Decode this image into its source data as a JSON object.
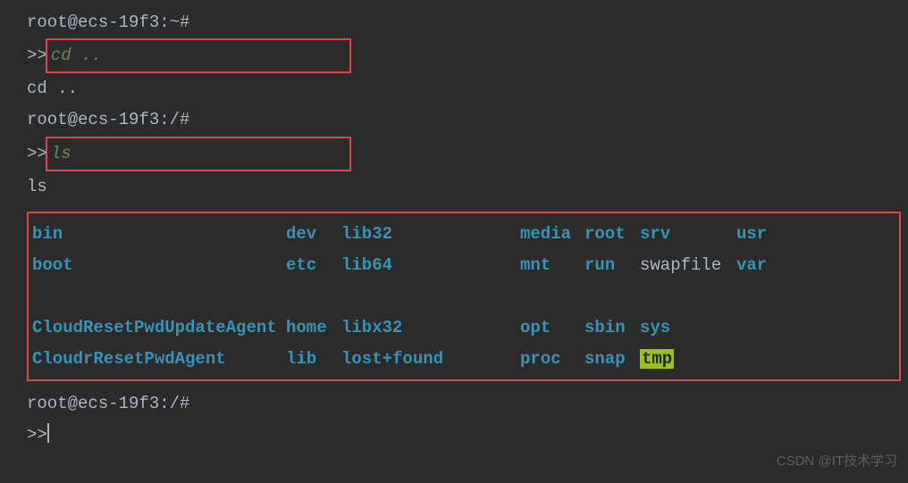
{
  "prompts": {
    "home": "root@ecs-19f3:~#",
    "root": "root@ecs-19f3:/#",
    "angles": ">>"
  },
  "commands": {
    "cd_up": "cd ..",
    "ls": "ls"
  },
  "echo": {
    "cd_up": "cd ..",
    "ls": "ls"
  },
  "ls_output": {
    "row1": {
      "c1": "bin",
      "c2": "dev",
      "c3": "lib32",
      "c4": "media",
      "c5": "root",
      "c6": "srv",
      "c7": "usr"
    },
    "row2": {
      "c1": "boot",
      "c2": "etc",
      "c3": "lib64",
      "c4": "mnt",
      "c5": "run",
      "c6": "swapfile",
      "c7": "var"
    },
    "row3": {
      "c1": "CloudResetPwdUpdateAgent",
      "c2": "home",
      "c3": "libx32",
      "c4": "opt",
      "c5": "sbin",
      "c6": "sys",
      "c7": ""
    },
    "row4": {
      "c1": "CloudrResetPwdAgent",
      "c2": "lib",
      "c3": "lost+found",
      "c4": "proc",
      "c5": "snap",
      "c6": "tmp",
      "c7": ""
    }
  },
  "watermark": "CSDN @IT技术学习"
}
